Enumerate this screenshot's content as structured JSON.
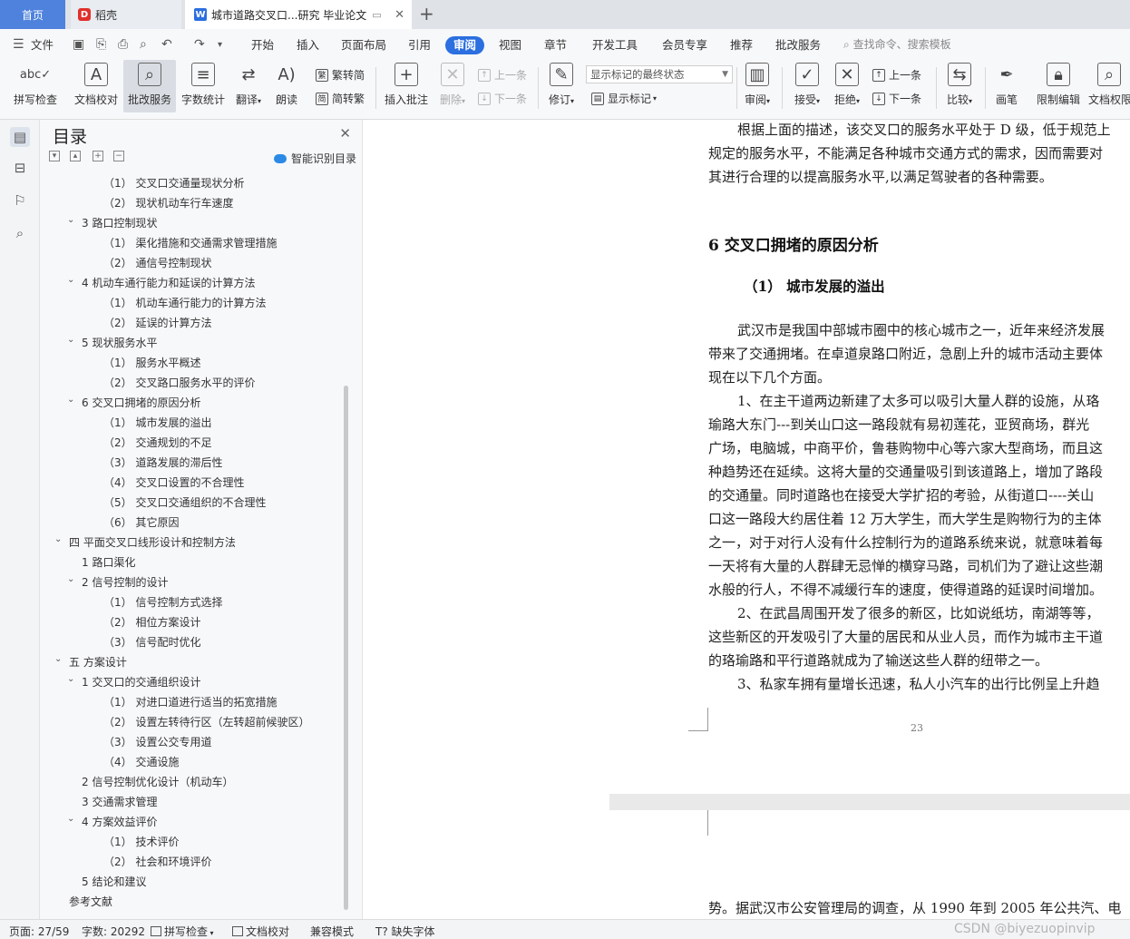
{
  "tabs": {
    "home": "首页",
    "daoke": "稻壳",
    "doc": "城市道路交叉口...研究 毕业论文"
  },
  "menu": {
    "file": "文件",
    "items": [
      "开始",
      "插入",
      "页面布局",
      "引用",
      "审阅",
      "视图",
      "章节",
      "开发工具",
      "会员专享",
      "推荐",
      "批改服务"
    ],
    "active": "审阅",
    "search": "查找命令、搜索模板"
  },
  "ribbon": {
    "spell_check": "拼写检查",
    "doc_proof": "文档校对",
    "correction_service": "批改服务",
    "word_count": "字数统计",
    "translate": "翻译",
    "read_aloud": "朗读",
    "trad_to_simp": "繁转简",
    "simp_to_trad": "简转繁",
    "insert_comment": "插入批注",
    "delete": "删除",
    "prev": "上一条",
    "next": "下一条",
    "revise": "修订",
    "markup_select": "显示标记的最终状态",
    "show_markup": "显示标记",
    "review": "审阅",
    "accept": "接受",
    "reject": "拒绝",
    "prev2": "上一条",
    "next2": "下一条",
    "compare": "比较",
    "pen": "画笔",
    "restrict_edit": "限制编辑",
    "doc_permission": "文档权限"
  },
  "toc": {
    "title": "目录",
    "smart": "智能识别目录",
    "items": [
      {
        "level": 3,
        "text": "（1）  交叉口交通量现状分析",
        "chev": ""
      },
      {
        "level": 3,
        "text": "（2）  现状机动车行车速度",
        "chev": ""
      },
      {
        "level": 2,
        "text": "3  路口控制现状",
        "chev": "v"
      },
      {
        "level": 3,
        "text": "（1）  渠化措施和交通需求管理措施",
        "chev": ""
      },
      {
        "level": 3,
        "text": "（2）  通信号控制现状",
        "chev": ""
      },
      {
        "level": 2,
        "text": "4  机动车通行能力和延误的计算方法",
        "chev": "v"
      },
      {
        "level": 3,
        "text": "（1）  机动车通行能力的计算方法",
        "chev": ""
      },
      {
        "level": 3,
        "text": "（2）  延误的计算方法",
        "chev": ""
      },
      {
        "level": 2,
        "text": "5  现状服务水平",
        "chev": "v"
      },
      {
        "level": 3,
        "text": "（1）  服务水平概述",
        "chev": ""
      },
      {
        "level": 3,
        "text": "（2）  交叉路口服务水平的评价",
        "chev": ""
      },
      {
        "level": 2,
        "text": "6  交叉口拥堵的原因分析",
        "chev": "v"
      },
      {
        "level": 3,
        "text": "（1）  城市发展的溢出",
        "chev": ""
      },
      {
        "level": 3,
        "text": "（2）  交通规划的不足",
        "chev": ""
      },
      {
        "level": 3,
        "text": "（3）  道路发展的滞后性",
        "chev": ""
      },
      {
        "level": 3,
        "text": "（4）  交叉口设置的不合理性",
        "chev": ""
      },
      {
        "level": 3,
        "text": "（5）  交叉口交通组织的不合理性",
        "chev": ""
      },
      {
        "level": 3,
        "text": "（6）  其它原因",
        "chev": ""
      },
      {
        "level": 1,
        "text": "四  平面交叉口线形设计和控制方法",
        "chev": "v"
      },
      {
        "level": 2,
        "text": "1  路口渠化",
        "chev": ""
      },
      {
        "level": 2,
        "text": "2  信号控制的设计",
        "chev": "v"
      },
      {
        "level": 3,
        "text": "（1）  信号控制方式选择",
        "chev": ""
      },
      {
        "level": 3,
        "text": "（2）  相位方案设计",
        "chev": ""
      },
      {
        "level": 3,
        "text": "（3）  信号配时优化",
        "chev": ""
      },
      {
        "level": 1,
        "text": "五  方案设计",
        "chev": "v"
      },
      {
        "level": 2,
        "text": "1  交叉口的交通组织设计",
        "chev": "v"
      },
      {
        "level": 3,
        "text": "（1）  对进口道进行适当的拓宽措施",
        "chev": ""
      },
      {
        "level": 3,
        "text": "（2）  设置左转待行区（左转超前候驶区）",
        "chev": ""
      },
      {
        "level": 3,
        "text": "（3）  设置公交专用道",
        "chev": ""
      },
      {
        "level": 3,
        "text": "（4）  交通设施",
        "chev": ""
      },
      {
        "level": 2,
        "text": "2  信号控制优化设计（机动车）",
        "chev": ""
      },
      {
        "level": 2,
        "text": "3  交通需求管理",
        "chev": ""
      },
      {
        "level": 2,
        "text": "4  方案效益评价",
        "chev": "v"
      },
      {
        "level": 3,
        "text": "（1）  技术评价",
        "chev": ""
      },
      {
        "level": 3,
        "text": "（2）  社会和环境评价",
        "chev": ""
      },
      {
        "level": 2,
        "text": "5  结论和建议",
        "chev": ""
      },
      {
        "level": 1,
        "text": "参考文献",
        "chev": ""
      }
    ]
  },
  "document": {
    "lines_top": [
      "根据上面的描述，该交叉口的服务水平处于 D 级，低于规范上",
      "规定的服务水平，不能满足各种城市交通方式的需求，因而需要对",
      "其进行合理的以提高服务水平,以满足驾驶者的各种需要。"
    ],
    "heading": "6  交叉口拥堵的原因分析",
    "subheading": "（1）  城市发展的溢出",
    "lines_body": [
      "武汉市是我国中部城市圈中的核心城市之一，近年来经济发展",
      "带来了交通拥堵。在卓道泉路口附近，急剧上升的城市活动主要体",
      "现在以下几个方面。",
      "1、在主干道两边新建了太多可以吸引大量人群的设施，从珞",
      "瑜路大东门---到关山口这一路段就有易初莲花，亚贸商场，群光",
      "广场，电脑城，中商平价，鲁巷购物中心等六家大型商场，而且这",
      "种趋势还在延续。这将大量的交通量吸引到该道路上，增加了路段",
      "的交通量。同时道路也在接受大学扩招的考验，从街道口----关山",
      "口这一路段大约居住着 12 万大学生，而大学生是购物行为的主体",
      "之一，对于对行人没有什么控制行为的道路系统来说，就意味着每",
      "一天将有大量的人群肆无忌惮的横穿马路，司机们为了避让这些潮",
      "水般的行人，不得不减缓行车的速度，使得道路的延误时间增加。",
      "2、在武昌周围开发了很多的新区，比如说纸坊，南湖等等，",
      "这些新区的开发吸引了大量的居民和从业人员，而作为城市主干道",
      "的珞瑜路和平行道路就成为了输送这些人群的纽带之一。",
      "3、私家车拥有量增长迅速，私人小汽车的出行比例呈上升趋"
    ],
    "page_number": "23",
    "page2_line": "势。据武汉市公安管理局的调查，从 1990 年到 2005 年公共汽、电"
  },
  "status": {
    "page": "页面: 27/59",
    "words": "字数: 20292",
    "spell": "拼写检查",
    "proof": "文档校对",
    "compat": "兼容模式",
    "missing_font": "缺失字体",
    "watermark": "CSDN @biyezuopinvip"
  }
}
